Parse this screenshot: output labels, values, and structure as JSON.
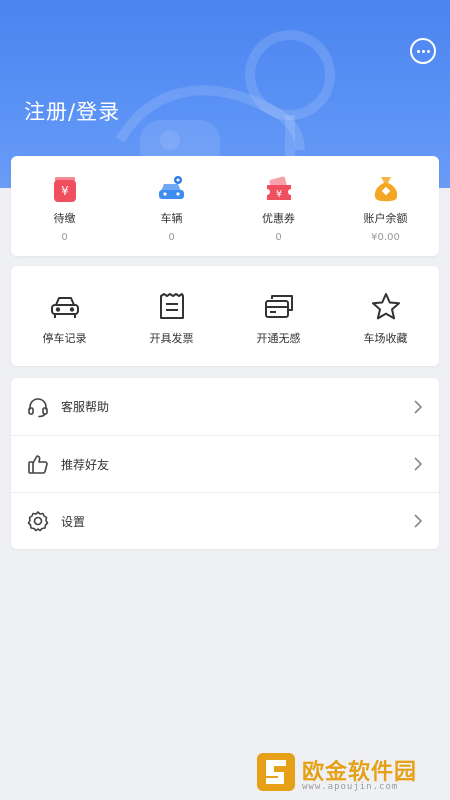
{
  "header": {
    "login_title": "注册/登录",
    "icon": "chat-bubble-icon",
    "gradient_colors": [
      "#4b84f0",
      "#6a9cf6"
    ]
  },
  "stats": [
    {
      "label": "待缴",
      "value": "0",
      "icon": "payment-icon",
      "color": "#ef4f5f"
    },
    {
      "label": "车辆",
      "value": "0",
      "icon": "car-location-icon",
      "color": "#3d8cf0"
    },
    {
      "label": "优惠券",
      "value": "0",
      "icon": "coupon-icon",
      "color": "#ef4f5f"
    },
    {
      "label": "账户余额",
      "value": "¥0.00",
      "icon": "money-bag-icon",
      "color": "#f5a623"
    }
  ],
  "tools": [
    {
      "label": "停车记录",
      "icon": "car-icon"
    },
    {
      "label": "开具发票",
      "icon": "invoice-icon"
    },
    {
      "label": "开通无感",
      "icon": "cards-icon"
    },
    {
      "label": "车场收藏",
      "icon": "star-icon"
    }
  ],
  "menu": [
    {
      "label": "客服帮助",
      "icon": "headset-icon"
    },
    {
      "label": "推荐好友",
      "icon": "thumbs-up-icon"
    },
    {
      "label": "设置",
      "icon": "settings-gear-icon"
    }
  ],
  "watermark": {
    "title": "欧金软件园",
    "url": "www.apoujin.com",
    "color": "#e5a018"
  }
}
